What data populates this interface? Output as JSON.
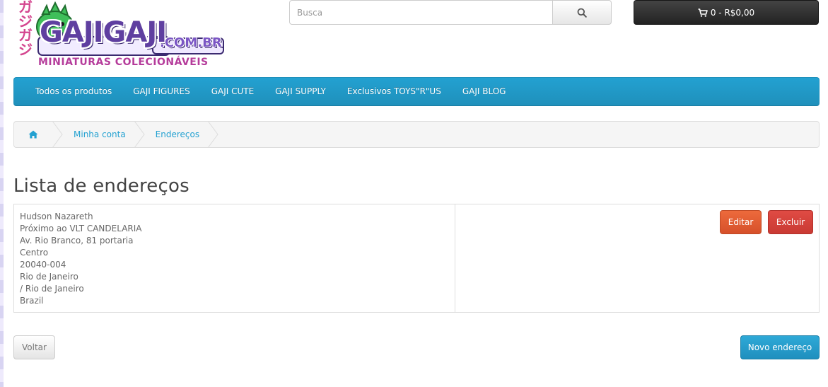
{
  "brand": {
    "logo_text": "GAJIGAJI",
    "domain": ".COM.BR",
    "tagline": "MINIATURAS COLECIONÁVEIS",
    "kana": "ガジガジ"
  },
  "search": {
    "placeholder": "Busca",
    "icon": "search-icon"
  },
  "cart": {
    "label": "0 - R$0,00",
    "icon": "shopping-cart-icon"
  },
  "menu": {
    "items": [
      {
        "label": "Todos os produtos"
      },
      {
        "label": "GAJI FIGURES"
      },
      {
        "label": "GAJI CUTE"
      },
      {
        "label": "GAJI SUPPLY"
      },
      {
        "label": "Exclusivos TOYS\"R\"US"
      },
      {
        "label": "GAJI BLOG"
      }
    ]
  },
  "breadcrumb": {
    "home_icon": "home-icon",
    "items": [
      {
        "label": "Minha conta"
      },
      {
        "label": "Endereços"
      }
    ]
  },
  "page": {
    "title": "Lista de endereços"
  },
  "address": {
    "lines": [
      "Hudson Nazareth",
      "Próximo ao VLT CANDELARIA",
      "Av. Rio Branco, 81 portaria",
      "Centro",
      "20040-004",
      "Rio de Janeiro",
      "/ Rio de Janeiro",
      "Brazil"
    ],
    "edit_label": "Editar",
    "delete_label": "Excluir"
  },
  "actions": {
    "back_label": "Voltar",
    "new_label": "Novo endereço"
  },
  "colors": {
    "menu": "#23a1d1",
    "link": "#23a1d1",
    "edit": "#e05a33",
    "delete": "#d0403a",
    "cart": "#333333"
  }
}
